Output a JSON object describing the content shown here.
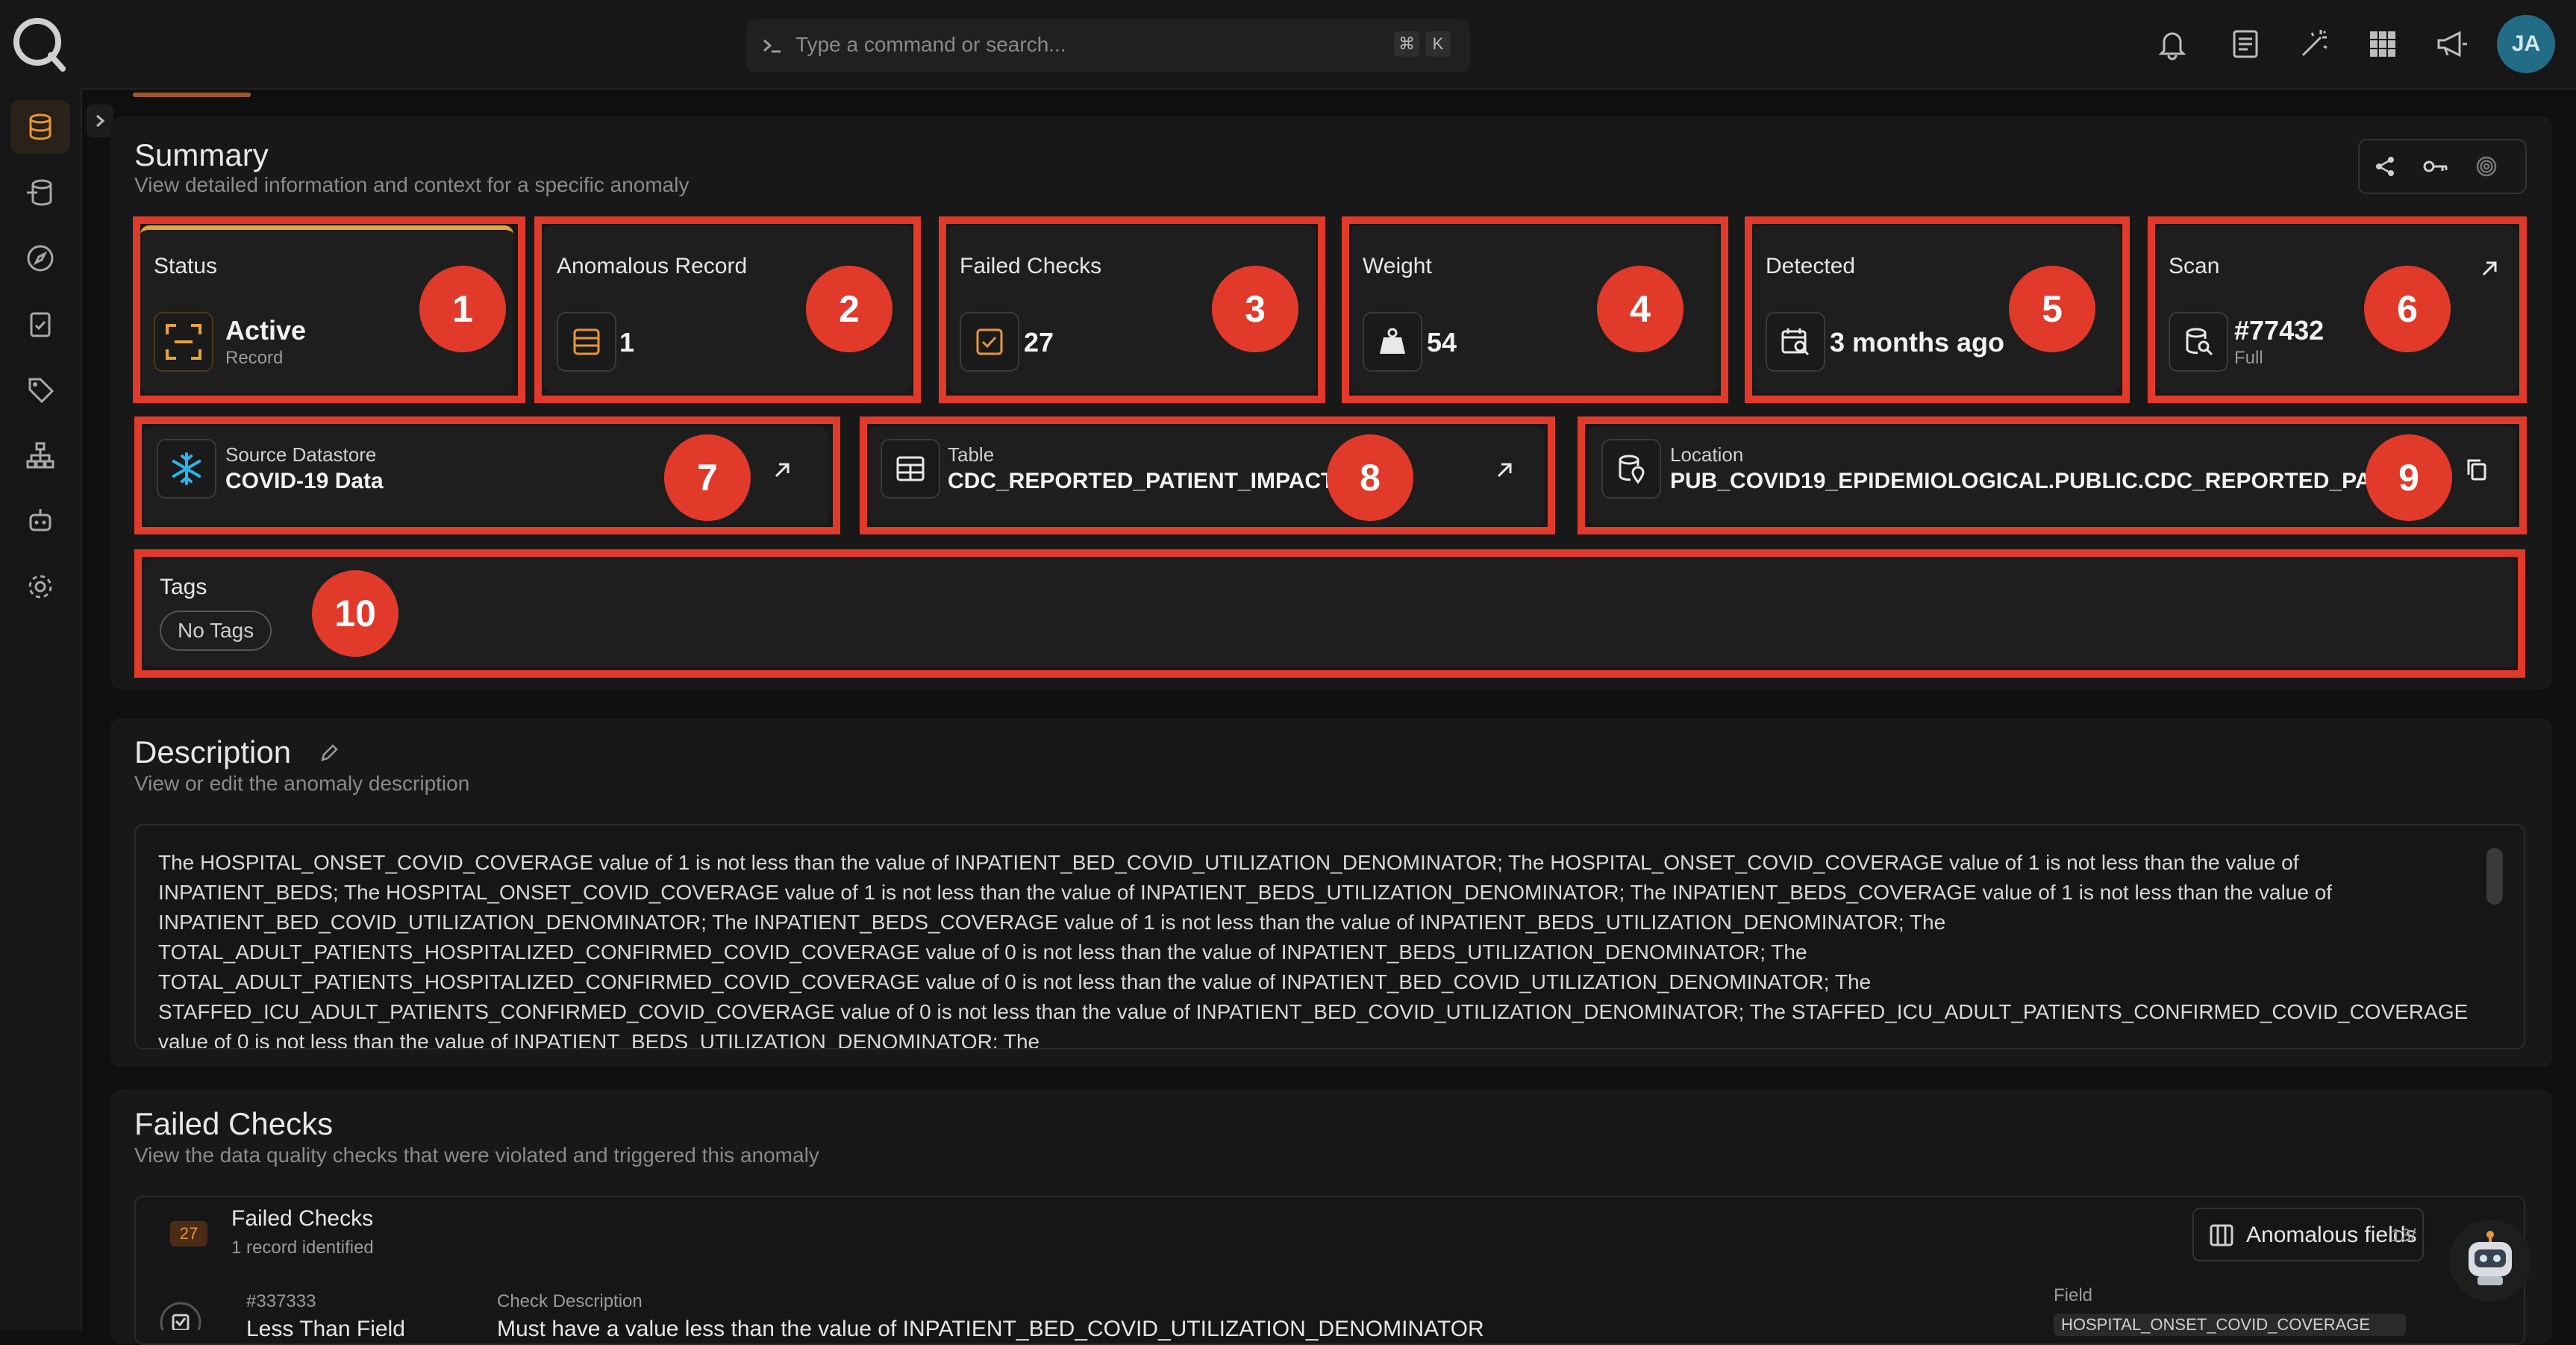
{
  "command_bar": {
    "placeholder": "Type a command or search...",
    "key1": "⌘",
    "key2": "K"
  },
  "user": {
    "initials": "JA"
  },
  "colors": {
    "accent": "#e8a33a",
    "highlight": "#e23a2a",
    "brand": "#236c86"
  },
  "summary": {
    "title": "Summary",
    "subtitle": "View detailed information and context for a specific anomaly",
    "cards": {
      "status": {
        "label": "Status",
        "value": "Active",
        "sub": "Record",
        "badge": "1"
      },
      "anomalous_record": {
        "label": "Anomalous Record",
        "value": "1",
        "badge": "2"
      },
      "failed_checks": {
        "label": "Failed Checks",
        "value": "27",
        "badge": "3"
      },
      "weight": {
        "label": "Weight",
        "value": "54",
        "badge": "4"
      },
      "detected": {
        "label": "Detected",
        "value": "3 months ago",
        "badge": "5"
      },
      "scan": {
        "label": "Scan",
        "value": "#77432",
        "sub": "Full",
        "badge": "6"
      }
    },
    "links": {
      "datastore": {
        "label": "Source Datastore",
        "value": "COVID-19 Data",
        "badge": "7"
      },
      "table": {
        "label": "Table",
        "value": "CDC_REPORTED_PATIENT_IMPACT",
        "badge": "8"
      },
      "location": {
        "label": "Location",
        "value": "PUB_COVID19_EPIDEMIOLOGICAL.PUBLIC.CDC_REPORTED_PATIENT_IMPACT",
        "badge": "9"
      }
    },
    "tags": {
      "label": "Tags",
      "empty": "No Tags",
      "badge": "10"
    }
  },
  "description": {
    "title": "Description",
    "subtitle": "View or edit the anomaly description",
    "text": "The HOSPITAL_ONSET_COVID_COVERAGE value of 1 is not less than the value of INPATIENT_BED_COVID_UTILIZATION_DENOMINATOR; The HOSPITAL_ONSET_COVID_COVERAGE value of 1 is not less than the value of INPATIENT_BEDS; The HOSPITAL_ONSET_COVID_COVERAGE value of 1 is not less than the value of INPATIENT_BEDS_UTILIZATION_DENOMINATOR; The INPATIENT_BEDS_COVERAGE value of 1 is not less than the value of INPATIENT_BED_COVID_UTILIZATION_DENOMINATOR; The INPATIENT_BEDS_COVERAGE value of 1 is not less than the value of INPATIENT_BEDS_UTILIZATION_DENOMINATOR; The TOTAL_ADULT_PATIENTS_HOSPITALIZED_CONFIRMED_COVID_COVERAGE value of 0 is not less than the value of INPATIENT_BEDS_UTILIZATION_DENOMINATOR; The TOTAL_ADULT_PATIENTS_HOSPITALIZED_CONFIRMED_COVID_COVERAGE value of 0 is not less than the value of INPATIENT_BED_COVID_UTILIZATION_DENOMINATOR; The STAFFED_ICU_ADULT_PATIENTS_CONFIRMED_COVID_COVERAGE value of 0 is not less than the value of INPATIENT_BED_COVID_UTILIZATION_DENOMINATOR; The STAFFED_ICU_ADULT_PATIENTS_CONFIRMED_COVID_COVERAGE value of 0 is not less than the value of INPATIENT_BEDS_UTILIZATION_DENOMINATOR; The"
  },
  "failed_checks": {
    "title": "Failed Checks",
    "subtitle": "View the data quality checks that were violated and triggered this anomaly",
    "box_title": "Failed Checks",
    "box_count": "27",
    "box_sub": "1 record identified",
    "fields_button": "Anomalous fields",
    "fields_count": "13/",
    "row": {
      "id": "#337333",
      "name": "Less Than Field",
      "desc_label": "Check Description",
      "desc_value": "Must have a value less than the value of INPATIENT_BED_COVID_UTILIZATION_DENOMINATOR",
      "field_label": "Field",
      "field_value": "HOSPITAL_ONSET_COVID_COVERAGE"
    }
  }
}
